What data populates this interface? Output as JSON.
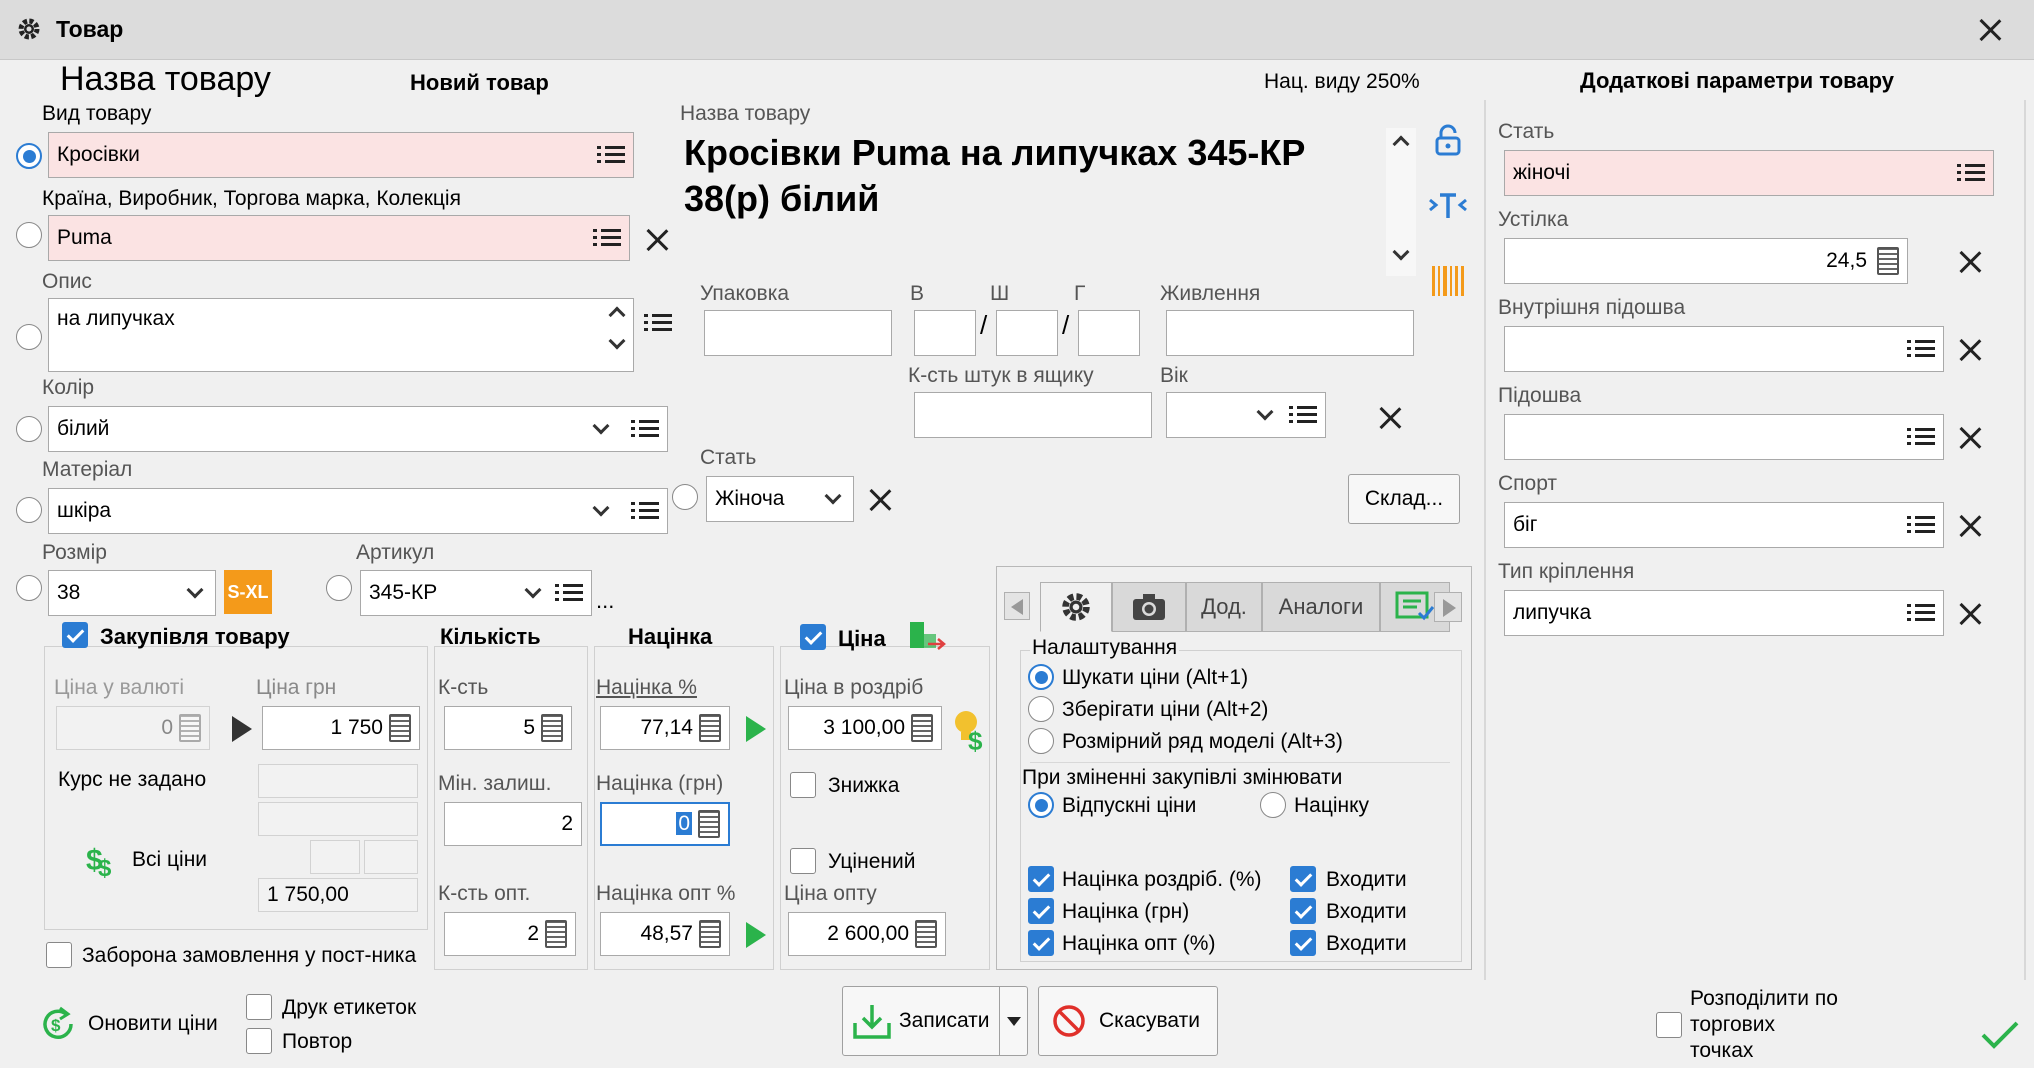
{
  "window": {
    "title": "Товар"
  },
  "header": {
    "product_name_caption": "Назва товару",
    "new_product": "Новий товар",
    "markup_type": "Нац. виду 250%",
    "additional_params": "Додаткові параметри товару"
  },
  "left": {
    "type_label": "Вид товару",
    "type_value": "Кросівки",
    "brand_label": "Країна, Виробник, Торгова марка, Колекція",
    "brand_value": "Puma",
    "desc_label": "Опис",
    "desc_value": "на липучках",
    "color_label": "Колір",
    "color_value": "білий",
    "material_label": "Матеріал",
    "material_value": "шкіра",
    "size_label": "Розмір",
    "size_value": "38",
    "size_badge": "S-XL",
    "article_label": "Артикул",
    "article_value": "345-КР",
    "article_more": "..."
  },
  "name": {
    "label": "Назва товару",
    "value": "Кросівки Puma на липучках 345-КР 38(р) білий"
  },
  "middle": {
    "pack_label": "Упаковка",
    "pack_value": "",
    "h_label": "В",
    "w_label": "Ш",
    "d_label": "Г",
    "slash": "/",
    "power_label": "Живлення",
    "box_label": "К-сть штук в ящику",
    "age_label": "Вік",
    "gender_label": "Стать",
    "gender_value": "Жіноча",
    "warehouse_button": "Склад..."
  },
  "purchase": {
    "title": "Закупівля товару",
    "currency_price_label": "Ціна у валюті",
    "currency_price_value": "0",
    "uah_price_label": "Ціна грн",
    "uah_price_value": "1 750",
    "rate_text": "Курс не задано",
    "all_prices": "Всі ціни",
    "total_value": "1 750,00",
    "no_order": "Заборона замовлення у пост-ника"
  },
  "quantity": {
    "title": "Кількість",
    "qty_label": "К-сть",
    "qty_value": "5",
    "min_label": "Мін. залиш.",
    "min_value": "2",
    "wholesale_label": "К-сть опт.",
    "wholesale_value": "2"
  },
  "markup": {
    "title": "Націнка",
    "pct_label": "Націнка %",
    "pct_value": "77,14",
    "uah_label": "Націнка (грн)",
    "uah_value": "0",
    "opt_label": "Націнка опт %",
    "opt_value": "48,57"
  },
  "price": {
    "title": "Ціна",
    "retail_label": "Ціна в роздріб",
    "retail_value": "3 100,00",
    "discount": "Знижка",
    "discounted": "Уцінений",
    "opt_label": "Ціна опту",
    "opt_value": "2 600,00"
  },
  "tabs": {
    "items": [
      "",
      "",
      "Дод.",
      "Аналоги",
      ""
    ],
    "settings_title": "Налаштування",
    "radio1": "Шукати ціни (Alt+1)",
    "radio2": "Зберігати ціни (Alt+2)",
    "radio3": "Розмірний ряд моделі (Alt+3)",
    "change_title": "При зміненні закупівлі змінювати",
    "opt_sale": "Відпускні ціни",
    "opt_markup": "Націнку",
    "c1": "Націнка роздріб. (%)",
    "c2": "Націнка (грн)",
    "c3": "Націнка опт (%)",
    "inc": "Входити"
  },
  "right": {
    "gender_label": "Стать",
    "gender_value": "жіночі",
    "insole_label": "Устілка",
    "insole_value": "24,5",
    "inner_sole_label": "Внутрішня підошва",
    "inner_sole_value": "",
    "sole_label": "Підошва",
    "sole_value": "",
    "sport_label": "Спорт",
    "sport_value": "біг",
    "fastening_label": "Тип кріплення",
    "fastening_value": "липучка"
  },
  "bottom": {
    "update_prices": "Оновити ціни",
    "print_labels": "Друк етикеток",
    "repeat": "Повтор",
    "save": "Записати",
    "cancel": "Скасувати",
    "distribute": "Розподілити по торгових точках"
  },
  "colors": {
    "accent": "#2b7cd3",
    "pink_field": "#fbe3e3",
    "green": "#2bb34b"
  }
}
